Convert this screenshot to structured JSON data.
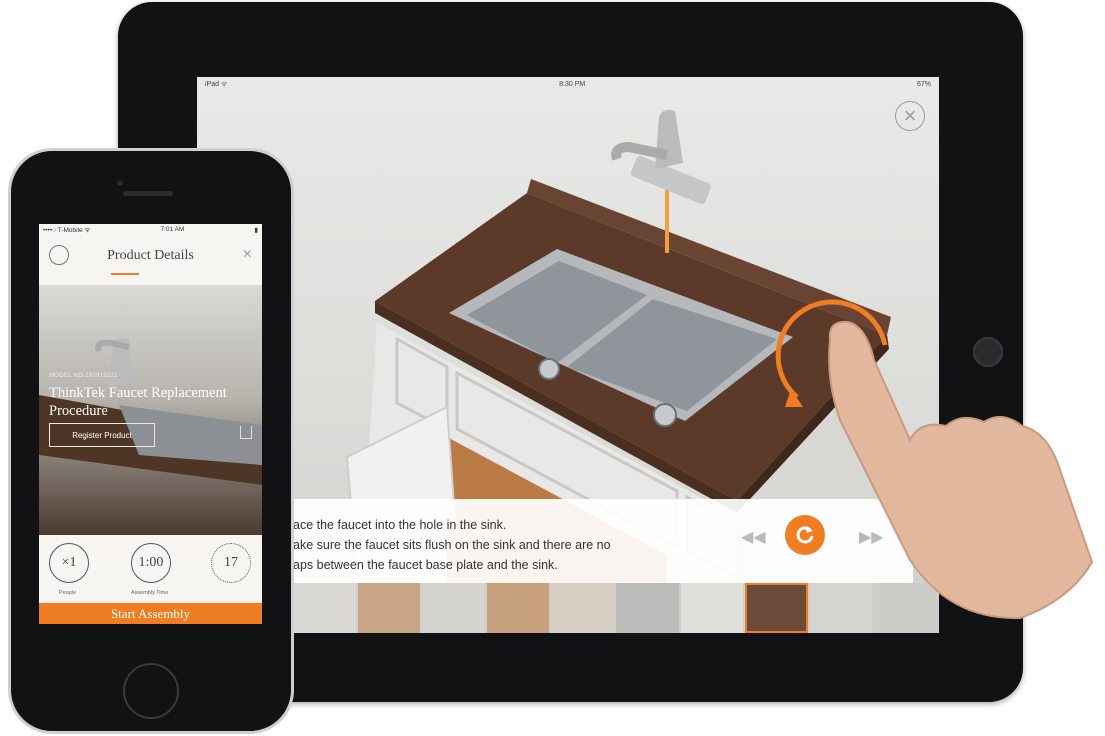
{
  "tablet": {
    "status": {
      "left": "iPad ᯤ",
      "time": "8:30 PM",
      "right": "67%"
    },
    "close_icon": "close-icon",
    "instruction_lines": [
      "ace the faucet into the hole in the sink.",
      "ake sure the faucet sits flush on the sink and there are no",
      "aps between the faucet base plate and the sink."
    ],
    "controls": {
      "prev_icon": "rewind-icon",
      "replay_icon": "replay-icon",
      "next_icon": "forward-icon"
    },
    "thumbnail_count": 10,
    "active_thumbnail": 8
  },
  "phone": {
    "status": {
      "carrier": "••••○ T-Mobile ᯤ",
      "time": "7:01 AM",
      "right": "▮"
    },
    "title": "Product Details",
    "model": "MODEL NO.292918221",
    "product_name": "ThinkTek Faucet Replacement Procedure",
    "register_label": "Register Product",
    "stats": [
      {
        "value": "×1",
        "label": "People"
      },
      {
        "value": "1:00",
        "label": "Assembly Time"
      },
      {
        "value": "17",
        "label": ""
      }
    ],
    "start_label": "Start Assembly"
  },
  "colors": {
    "accent": "#f07d22",
    "counter": "#5b3a2a",
    "sink": "#8f959a"
  }
}
